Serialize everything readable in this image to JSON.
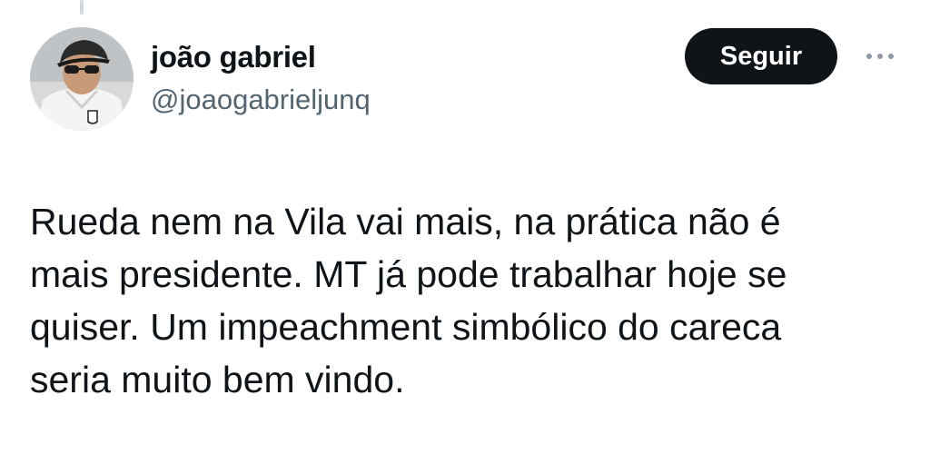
{
  "user": {
    "display_name": "joão gabriel",
    "handle": "@joaogabrieljunq"
  },
  "actions": {
    "follow_label": "Seguir",
    "more_icon": "more-horizontal-icon"
  },
  "tweet": {
    "lines": [
      "Rueda nem na Vila vai mais, na prática não é",
      "mais presidente. MT já pode trabalhar hoje se",
      "quiser. Um impeachment simbólico do careca",
      "seria muito bem vindo."
    ]
  },
  "colors": {
    "text": "#0f1419",
    "secondary_text": "#536471",
    "button_bg": "#0f1419",
    "button_text": "#ffffff"
  }
}
